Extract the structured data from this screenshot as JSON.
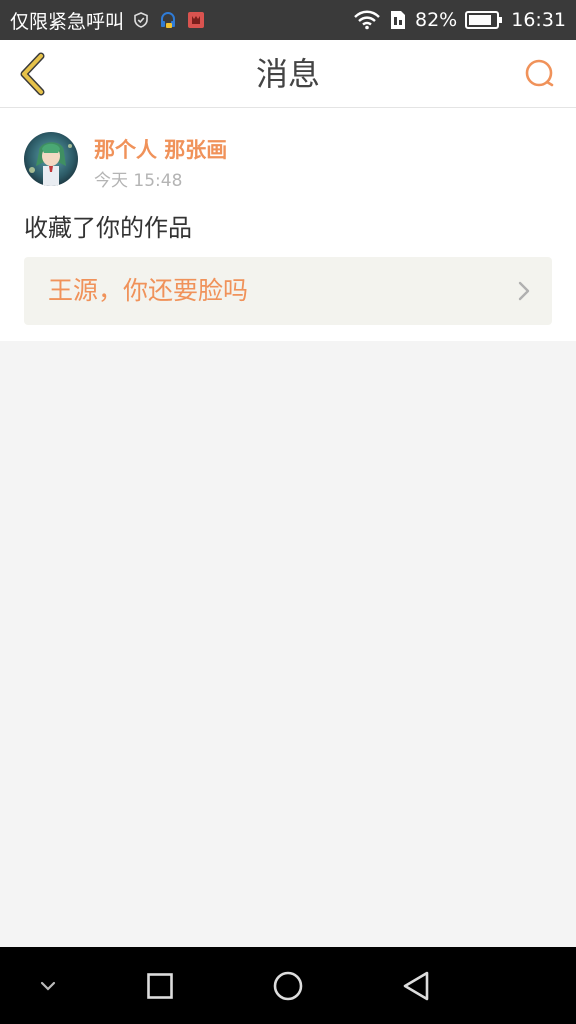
{
  "status_bar": {
    "carrier_text": "仅限紧急呼叫",
    "battery_percent": "82%",
    "time": "16:31"
  },
  "header": {
    "title": "消息",
    "back_icon": "chevron-left-icon",
    "search_icon": "search-icon"
  },
  "message": {
    "sender_name": "那个人 那张画",
    "timestamp": "今天 15:48",
    "text": "收藏了你的作品",
    "work_title": "王源，你还要脸吗"
  },
  "colors": {
    "accent": "#f0925a",
    "back_icon": "#e6c24a",
    "status_bar_bg": "#3a3a3a",
    "page_bg": "#f4f4f4"
  },
  "nav_bar": {
    "icons": [
      "chevron-down-icon",
      "square-recent-apps-icon",
      "circle-home-icon",
      "triangle-back-icon"
    ]
  }
}
